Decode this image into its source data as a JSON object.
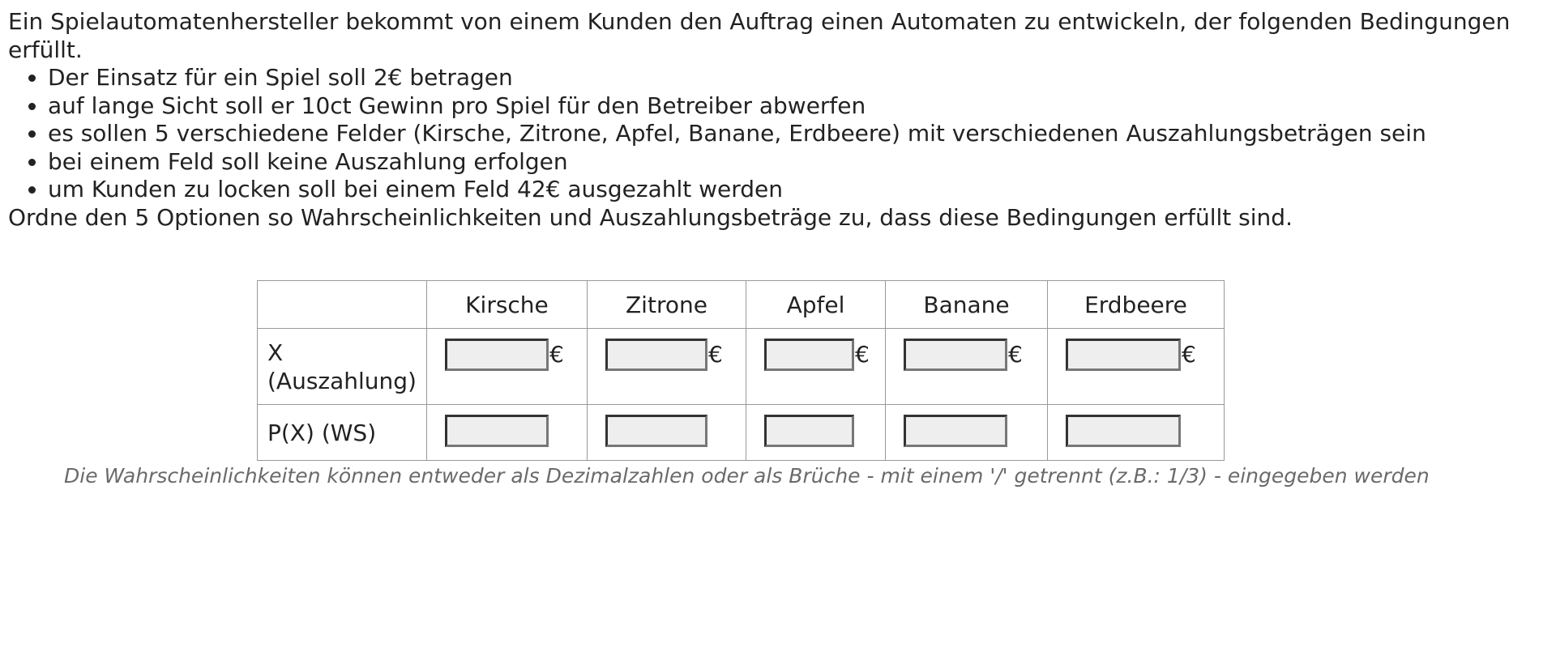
{
  "intro": "Ein Spielautomatenhersteller bekommt von einem Kunden den Auftrag einen Automaten zu entwickeln, der folgenden Bedingungen erfüllt.",
  "conditions": [
    "Der Einsatz für ein Spiel soll 2€ betragen",
    "auf lange Sicht soll er 10ct Gewinn pro Spiel für den Betreiber abwerfen",
    "es sollen 5 verschiedene Felder (Kirsche, Zitrone, Apfel, Banane, Erdbeere) mit verschiedenen Auszahlungsbeträgen sein",
    "bei einem Feld soll keine Auszahlung erfolgen",
    "um Kunden zu locken soll bei einem Feld 42€ ausgezahlt werden"
  ],
  "task": "Ordne den 5 Optionen so Wahrscheinlichkeiten und Auszahlungsbeträge zu, dass diese Bedingungen erfüllt sind.",
  "table": {
    "columns": [
      "Kirsche",
      "Zitrone",
      "Apfel",
      "Banane",
      "Erdbeere"
    ],
    "row_x_label_line1": "X",
    "row_x_label_line2": "(Auszahlung)",
    "row_p_label": "P(X) (WS)",
    "currency": "€",
    "payout_values": [
      "",
      "",
      "",
      "",
      ""
    ],
    "probability_values": [
      "",
      "",
      "",
      "",
      ""
    ]
  },
  "hint": "Die Wahrscheinlichkeiten können entweder als Dezimalzahlen oder als Brüche - mit einem '/' getrennt (z.B.: 1/3) - eingegeben werden"
}
